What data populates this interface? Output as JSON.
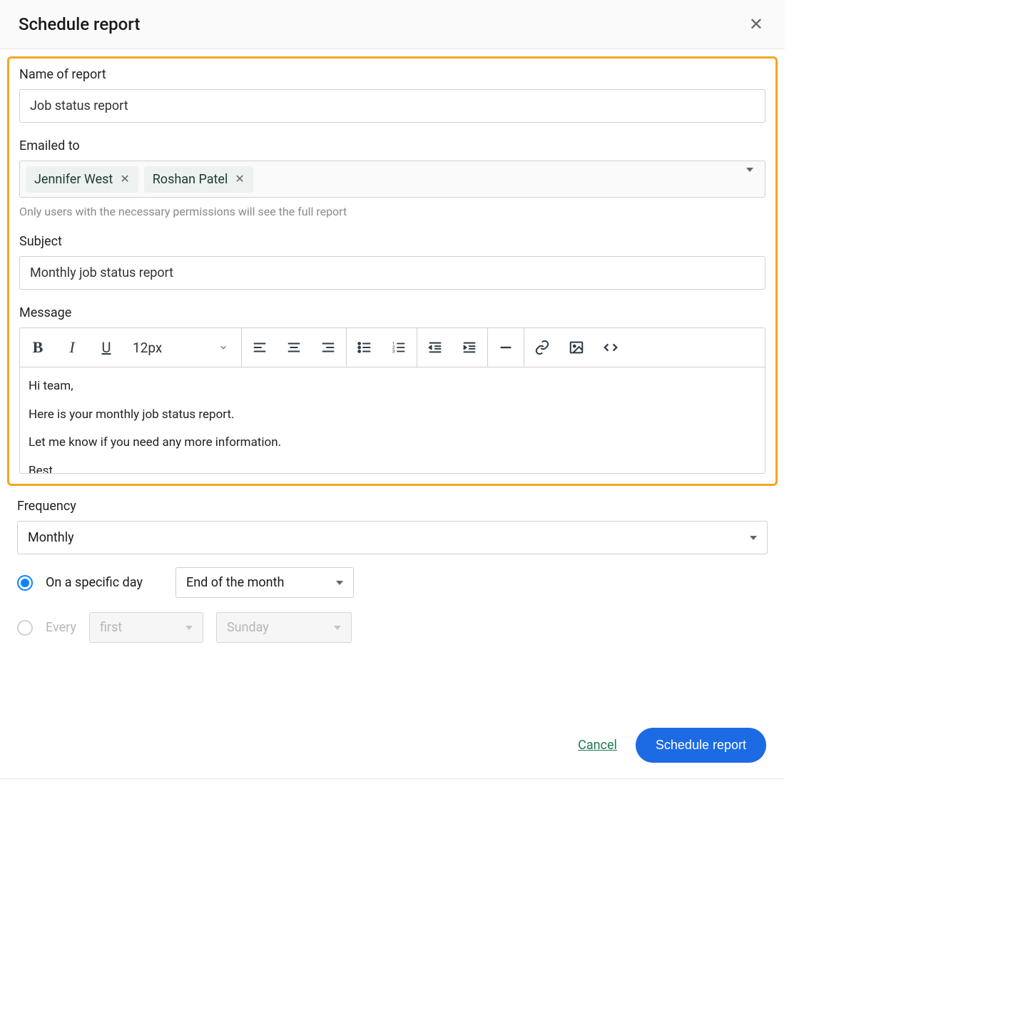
{
  "header": {
    "title": "Schedule report"
  },
  "form": {
    "name_label": "Name of report",
    "name_value": "Job status report",
    "emailed_label": "Emailed to",
    "recipients": [
      "Jennifer West",
      "Roshan Patel"
    ],
    "emailed_helper": "Only users with the necessary permissions will see the full report",
    "subject_label": "Subject",
    "subject_value": "Monthly job status report",
    "message_label": "Message",
    "font_size": "12px",
    "message_lines": [
      "Hi team,",
      "Here is your monthly job status report.",
      "Let me know if you need any more information.",
      "Best,"
    ]
  },
  "frequency": {
    "label": "Frequency",
    "value": "Monthly",
    "option_specific_label": "On a specific day",
    "option_specific_value": "End of the month",
    "option_every_label": "Every",
    "every_ordinal": "first",
    "every_day": "Sunday"
  },
  "footer": {
    "cancel": "Cancel",
    "submit": "Schedule report"
  }
}
